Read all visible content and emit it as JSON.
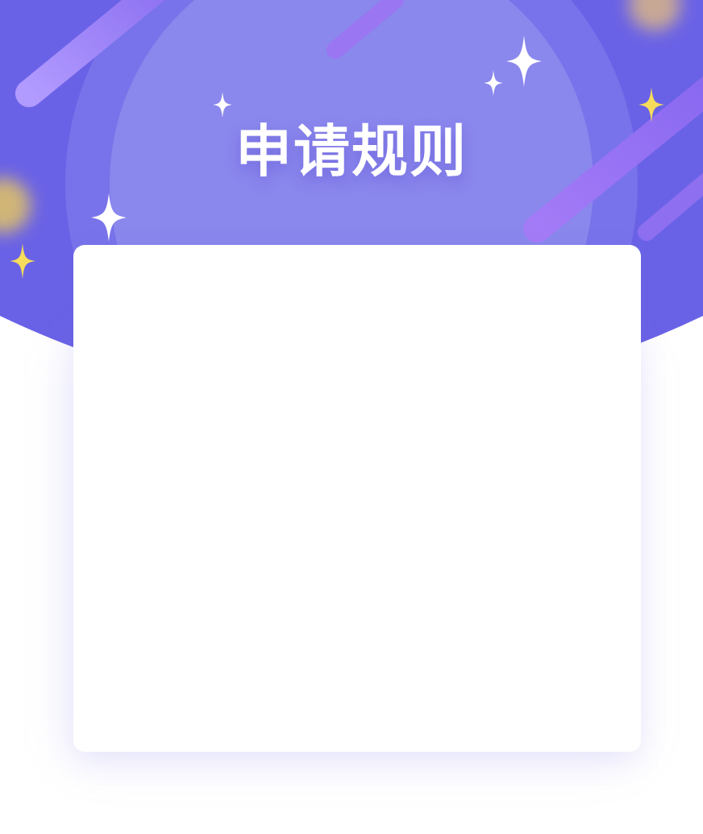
{
  "header": {
    "title": "申请规则"
  },
  "theme": {
    "banner_color": "#6a62e6",
    "inner_circle_color": "#7873ea",
    "core_circle_color": "#8a87ed",
    "streak_color": "#9a7af5",
    "sparkle_white": "#ffffff",
    "sparkle_yellow": "#f6dc5a",
    "card_color": "#ffffff"
  },
  "icons": {
    "sparkle": "four-point-star-icon",
    "streak": "meteor-streak-icon",
    "glow": "blurred-glow-orb"
  },
  "rules_card": {
    "content": ""
  }
}
